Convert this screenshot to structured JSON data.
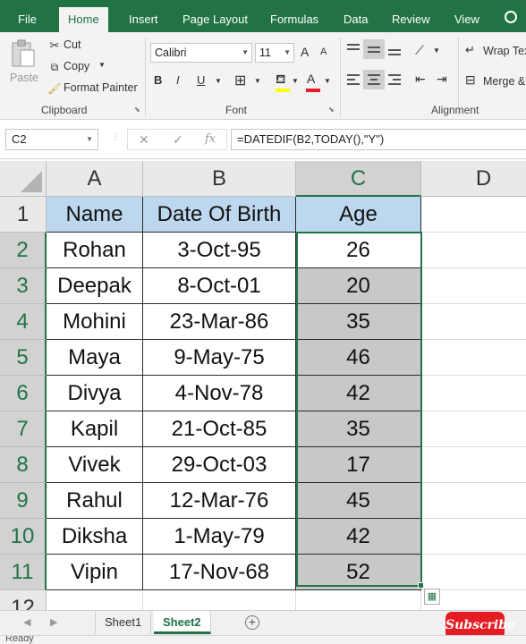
{
  "tabs": {
    "file": "File",
    "home": "Home",
    "insert": "Insert",
    "page_layout": "Page Layout",
    "formulas": "Formulas",
    "data": "Data",
    "review": "Review",
    "view": "View"
  },
  "ribbon": {
    "clipboard": {
      "paste": "Paste",
      "cut": "Cut",
      "copy": "Copy",
      "format_painter": "Format Painter",
      "group_label": "Clipboard"
    },
    "font": {
      "font_name": "Calibri",
      "font_size": "11",
      "bold": "B",
      "italic": "I",
      "underline": "U",
      "grow": "A",
      "shrink": "A",
      "font_color_glyph": "A",
      "group_label": "Font"
    },
    "alignment": {
      "wrap_text": "Wrap Tex",
      "merge": "Merge &",
      "group_label": "Alignment"
    }
  },
  "formula_bar": {
    "name_box": "C2",
    "fx": "fx",
    "formula": "=DATEDIF(B2,TODAY(),\"Y\")"
  },
  "grid": {
    "columns": [
      "A",
      "B",
      "C",
      "D"
    ],
    "row_numbers": [
      "1",
      "2",
      "3",
      "4",
      "5",
      "6",
      "7",
      "8",
      "9",
      "10",
      "11",
      "12"
    ],
    "header_row": [
      "Name",
      "Date Of Birth",
      "Age"
    ],
    "rows": [
      [
        "Rohan",
        "3-Oct-95",
        "26"
      ],
      [
        "Deepak",
        "8-Oct-01",
        "20"
      ],
      [
        "Mohini",
        "23-Mar-86",
        "35"
      ],
      [
        "Maya",
        "9-May-75",
        "46"
      ],
      [
        "Divya",
        "4-Nov-78",
        "42"
      ],
      [
        "Kapil",
        "21-Oct-85",
        "35"
      ],
      [
        "Vivek",
        "29-Oct-03",
        "17"
      ],
      [
        "Rahul",
        "12-Mar-76",
        "45"
      ],
      [
        "Diksha",
        "1-May-79",
        "42"
      ],
      [
        "Vipin",
        "17-Nov-68",
        "52"
      ]
    ]
  },
  "sheets": [
    "Sheet1",
    "Sheet2"
  ],
  "active_sheet": "Sheet2",
  "subscribe": "Subscribe",
  "status": "Ready",
  "colors": {
    "excel_green": "#217346",
    "header_fill": "#bdd7ee",
    "selection_fill": "#c8c8c8",
    "subscribe_red": "#e51c23"
  }
}
